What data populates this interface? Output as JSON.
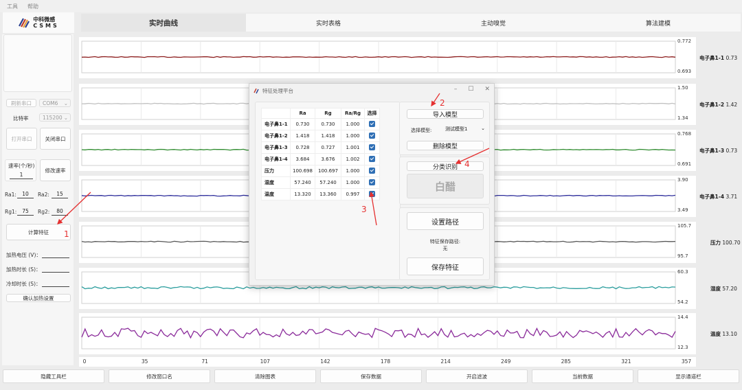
{
  "menu": [
    "工具",
    "帮助"
  ],
  "logo": {
    "cn": "中科微感",
    "en": "CSMS"
  },
  "tabs": [
    "实时曲线",
    "实时表格",
    "主动嗅觉",
    "算法建模"
  ],
  "left_panel": {
    "refresh_port": "刷新串口",
    "port_value": "COM6",
    "baud_label": "比特率",
    "baud_value": "115200",
    "open_port": "打开串口",
    "close_port": "关闭串口",
    "rate_label": "速率(个/秒)",
    "rate_value": "1",
    "modify_rate": "修改速率",
    "ra1_label": "Ra1:",
    "ra1_value": "10",
    "ra2_label": "Ra2:",
    "ra2_value": "15",
    "rg1_label": "Rg1:",
    "rg1_value": "75",
    "rg2_label": "Rg2:",
    "rg2_value": "80",
    "calc_feature": "计算特征",
    "heat_voltage": "加热电压 (V)：",
    "heat_time": "加热时长 (S)：",
    "cool_time": "冷却时长 (S)：",
    "confirm_heat": "确认加热设置"
  },
  "charts": [
    {
      "name": "电子鼻1-1",
      "value": "0.73",
      "ymax": "0.772",
      "ymin": "0.693",
      "color": "#8b1a1a"
    },
    {
      "name": "电子鼻1-2",
      "value": "1.42",
      "ymax": "1.50",
      "ymin": "1.34",
      "color": "#c0c0c0"
    },
    {
      "name": "电子鼻1-3",
      "value": "0.73",
      "ymax": "0.768",
      "ymin": "0.691",
      "color": "#2e8b2e"
    },
    {
      "name": "电子鼻1-4",
      "value": "3.71",
      "ymax": "3.90",
      "ymin": "3.49",
      "color": "#2b2b9a"
    },
    {
      "name": "压力",
      "value": "100.70",
      "ymax": "105.7",
      "ymin": "95.7",
      "color": "#555555"
    },
    {
      "name": "湿度",
      "value": "57.20",
      "ymax": "60.3",
      "ymin": "54.2",
      "color": "#2a9d9d"
    },
    {
      "name": "温度",
      "value": "13.10",
      "ymax": "14.4",
      "ymin": "12.3",
      "color": "#8a2a9a"
    }
  ],
  "x_ticks": [
    "0",
    "35",
    "71",
    "107",
    "142",
    "178",
    "214",
    "249",
    "285",
    "321",
    "357"
  ],
  "bottom_buttons": [
    "隐藏工具栏",
    "修改窗口名",
    "清除图表",
    "保存数据",
    "开启滤波",
    "当前数据",
    "显示通道栏"
  ],
  "dialog": {
    "title": "特征处理平台",
    "columns": [
      "",
      "Ra",
      "Rg",
      "Ra/Rg",
      "选择"
    ],
    "rows": [
      {
        "name": "电子鼻1-1",
        "ra": "0.730",
        "rg": "0.730",
        "ratio": "1.000"
      },
      {
        "name": "电子鼻1-2",
        "ra": "1.418",
        "rg": "1.418",
        "ratio": "1.000"
      },
      {
        "name": "电子鼻1-3",
        "ra": "0.728",
        "rg": "0.727",
        "ratio": "1.001"
      },
      {
        "name": "电子鼻1-4",
        "ra": "3.684",
        "rg": "3.676",
        "ratio": "1.002"
      },
      {
        "name": "压力",
        "ra": "100.698",
        "rg": "100.697",
        "ratio": "1.000"
      },
      {
        "name": "湿度",
        "ra": "57.240",
        "rg": "57.240",
        "ratio": "1.000"
      },
      {
        "name": "温度",
        "ra": "13.320",
        "rg": "13.360",
        "ratio": "0.997"
      }
    ],
    "import_model": "导入模型",
    "select_model_label": "选择模型:",
    "select_model_value": "测试模型1",
    "delete_model": "删除模型",
    "classify": "分类识别",
    "result": "白醋",
    "set_path": "设置路径",
    "save_path_label": "特征保存路径:",
    "save_path_value": "无",
    "save_feature": "保存特征"
  },
  "annotations": [
    "1",
    "2",
    "3",
    "4"
  ]
}
